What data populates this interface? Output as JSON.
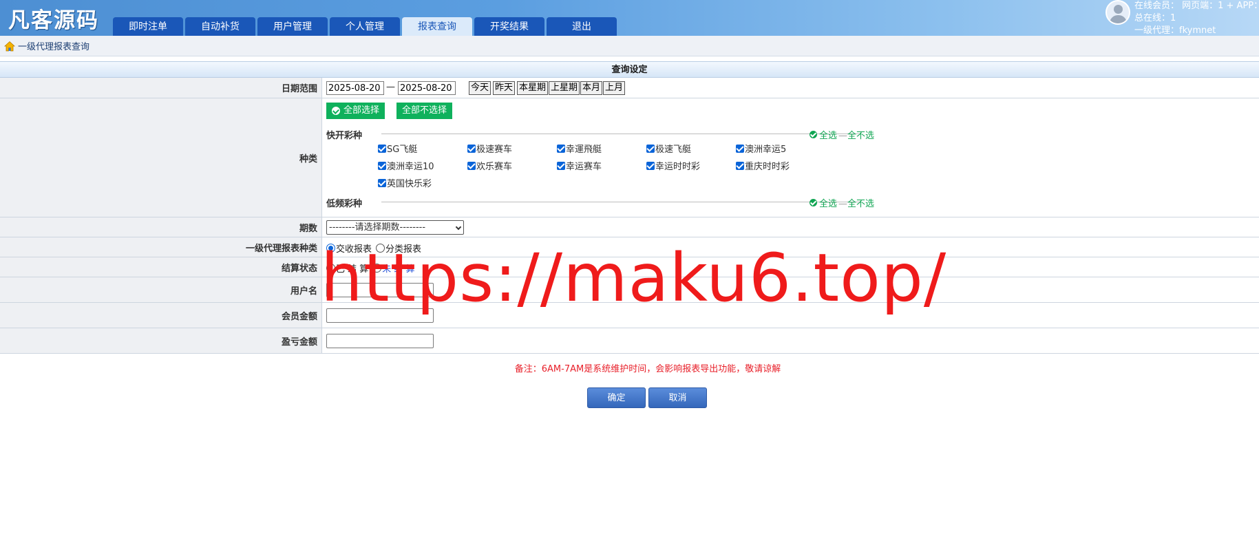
{
  "app": {
    "logo": "凡客源码"
  },
  "nav": {
    "tabs": [
      {
        "label": "即时注单",
        "active": false
      },
      {
        "label": "自动补货",
        "active": false
      },
      {
        "label": "用户管理",
        "active": false
      },
      {
        "label": "个人管理",
        "active": false
      },
      {
        "label": "报表查询",
        "active": true
      },
      {
        "label": "开奖结果",
        "active": false
      },
      {
        "label": "退出",
        "active": false
      }
    ]
  },
  "user": {
    "line1": "在线会员：  网页端：1 + APP：",
    "line2": "总在线：1",
    "line3": "一级代理：fkymnet"
  },
  "breadcrumb": {
    "text": "一级代理报表查询"
  },
  "form": {
    "section_title": "查询设定",
    "date_range": {
      "label": "日期范围",
      "start": "2025-08-20",
      "separator": "—",
      "end": "2025-08-20",
      "quick_buttons": [
        "今天",
        "昨天",
        "本星期",
        "上星期",
        "本月",
        "上月"
      ]
    },
    "category": {
      "label": "种类",
      "select_all": "全部选择",
      "deselect_all": "全部不选择",
      "groups": [
        {
          "name": "快开彩种",
          "select_all": "全选",
          "deselect_all": "全不选",
          "items": [
            {
              "label": "SG飞艇",
              "checked": true
            },
            {
              "label": "极速赛车",
              "checked": true
            },
            {
              "label": "幸運飛艇",
              "checked": true
            },
            {
              "label": "极速飞艇",
              "checked": true
            },
            {
              "label": "澳洲幸运5",
              "checked": true
            },
            {
              "label": "澳洲幸运10",
              "checked": true
            },
            {
              "label": "欢乐赛车",
              "checked": true
            },
            {
              "label": "幸运赛车",
              "checked": true
            },
            {
              "label": "幸运时时彩",
              "checked": true
            },
            {
              "label": "重庆时时彩",
              "checked": true
            },
            {
              "label": "英国快乐彩",
              "checked": true
            }
          ]
        },
        {
          "name": "低频彩种",
          "select_all": "全选",
          "deselect_all": "全不选",
          "items": []
        }
      ]
    },
    "period": {
      "label": "期数",
      "selected": "--------请选择期数--------"
    },
    "report_type": {
      "label": "一级代理报表种类",
      "options": [
        {
          "label": "交收报表",
          "selected": true
        },
        {
          "label": "分类报表",
          "selected": false
        }
      ]
    },
    "settlement": {
      "label": "结算状态",
      "options": [
        {
          "label": "已 结 算",
          "selected": false
        },
        {
          "label": "未 结 算",
          "selected": false
        }
      ]
    },
    "username": {
      "label": "用户名",
      "value": ""
    },
    "member_amount": {
      "label": "会员金额",
      "value": ""
    },
    "profit_amount": {
      "label": "盈亏金额",
      "value": ""
    }
  },
  "note": "备注：6AM-7AM是系统维护时间，会影响报表导出功能，敬请谅解",
  "actions": {
    "confirm": "确定",
    "cancel": "取消"
  },
  "watermark": "https://maku6.top/"
}
